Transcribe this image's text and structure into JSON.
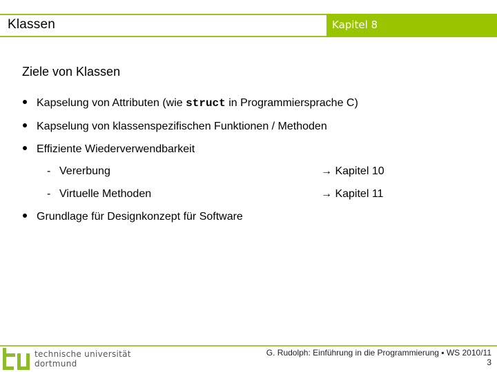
{
  "header": {
    "title": "Klassen",
    "chapter": "Kapitel 8",
    "accent_color": "#99c500"
  },
  "content": {
    "section_title": "Ziele von Klassen",
    "bullets": [
      {
        "prefix": "Kapselung von Attributen (wie ",
        "code": "struct",
        "suffix": " in Programmiersprache C)"
      },
      {
        "text": "Kapselung von klassenspezifischen Funktionen / Methoden"
      },
      {
        "text": "Effiziente Wiederverwendbarkeit"
      },
      {
        "text": "Grundlage für Designkonzept für Software"
      }
    ],
    "sub_items": [
      {
        "dash": "-",
        "text": "Vererbung",
        "ref": "→ Kapitel 10"
      },
      {
        "dash": "-",
        "text": "Virtuelle Methoden",
        "ref": "→ Kapitel 11"
      }
    ]
  },
  "footer": {
    "logo_icon": "tu-logo-icon",
    "institution_line1": "technische universität",
    "institution_line2": "dortmund",
    "credit": "G. Rudolph: Einführung in die Programmierung ▪ WS 2010/11",
    "page_number": "3"
  }
}
